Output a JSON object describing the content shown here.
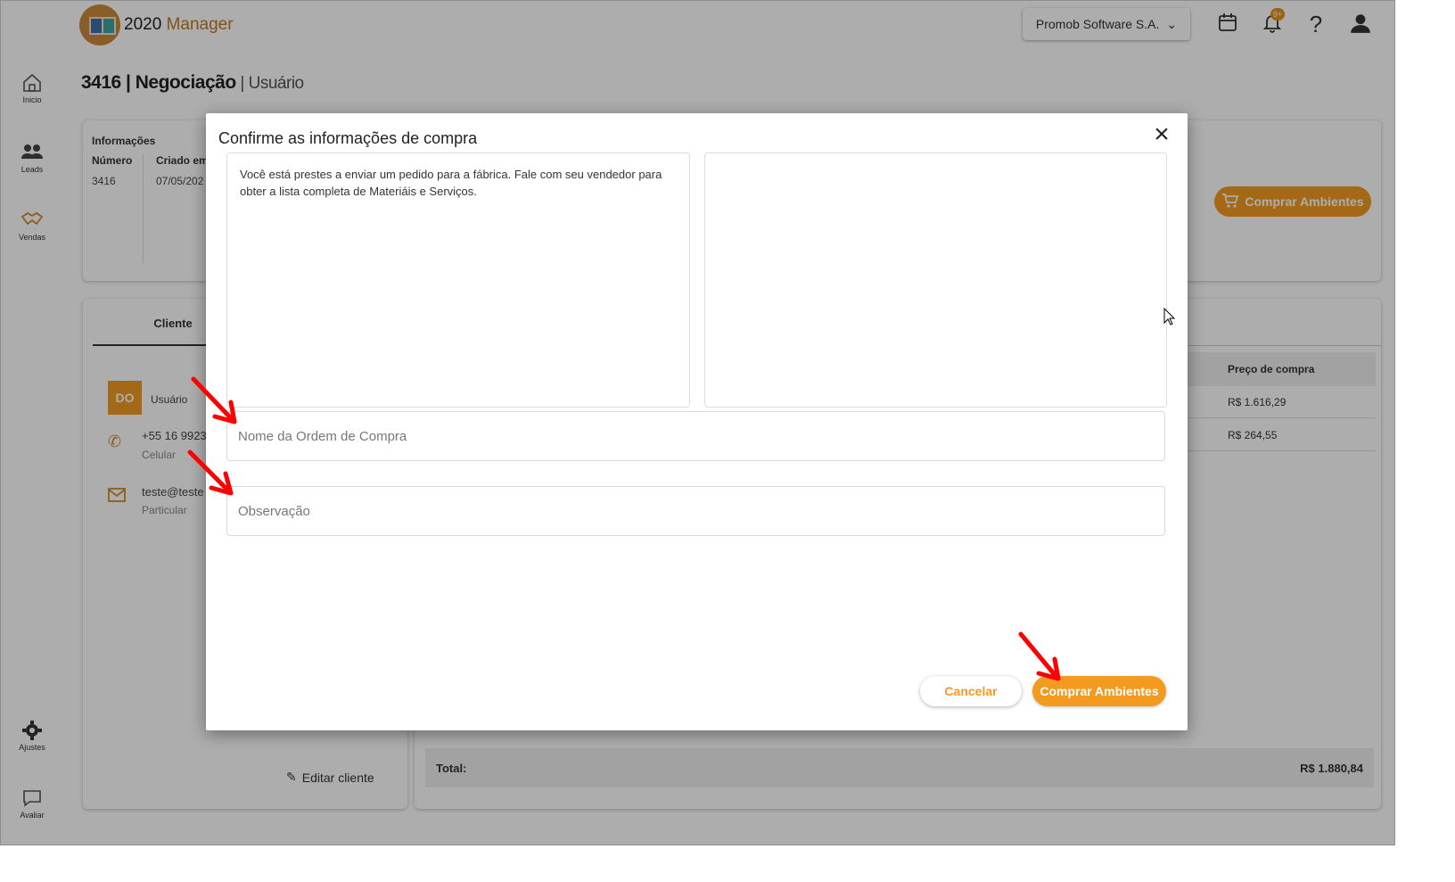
{
  "app": {
    "logo_num": "2020",
    "logo_name": " Manager"
  },
  "header": {
    "company_select": "Promob Software S.A.",
    "notification_badge": "9+"
  },
  "sidebar": {
    "items": [
      {
        "label": "Inicio",
        "icon": "home-icon"
      },
      {
        "label": "Leads",
        "icon": "people-icon"
      },
      {
        "label": "Vendas",
        "icon": "handshake-icon"
      },
      {
        "label": "Ajustes",
        "icon": "gear-icon"
      },
      {
        "label": "Avaliar",
        "icon": "chat-icon"
      }
    ]
  },
  "page": {
    "title": "3416 | Negociação",
    "subtitle": " | Usuário"
  },
  "info": {
    "heading": "Informações",
    "number_label": "Número",
    "number_value": "3416",
    "created_label": "Criado em",
    "created_value": "07/05/202"
  },
  "client": {
    "tab": "Cliente",
    "avatar": "DO",
    "name": "Usuário",
    "phone": "+55 16 9923",
    "phone_type": "Celular",
    "email": "teste@teste",
    "email_type": "Particular",
    "edit_label": "Editar cliente"
  },
  "purchase": {
    "button": "Comprar Ambientes",
    "column_header": "Preço de compra",
    "rows": [
      "R$ 1.616,29",
      "R$ 264,55"
    ],
    "total_label": "Total:",
    "total_value": "R$ 1.880,84"
  },
  "modal": {
    "title": "Confirme as informações de compra",
    "message": "Você está prestes a enviar um pedido para a fábrica. Fale com seu vendedor para obter a lista completa de Materiáis e Serviços.",
    "order_name_placeholder": "Nome da Ordem de Compra",
    "order_name_value": "",
    "observation_placeholder": "Observação",
    "observation_value": "",
    "cancel_label": "Cancelar",
    "buy_label": "Comprar Ambientes"
  },
  "colors": {
    "accent": "#f39a21",
    "annotation_arrow": "#ff0000"
  }
}
